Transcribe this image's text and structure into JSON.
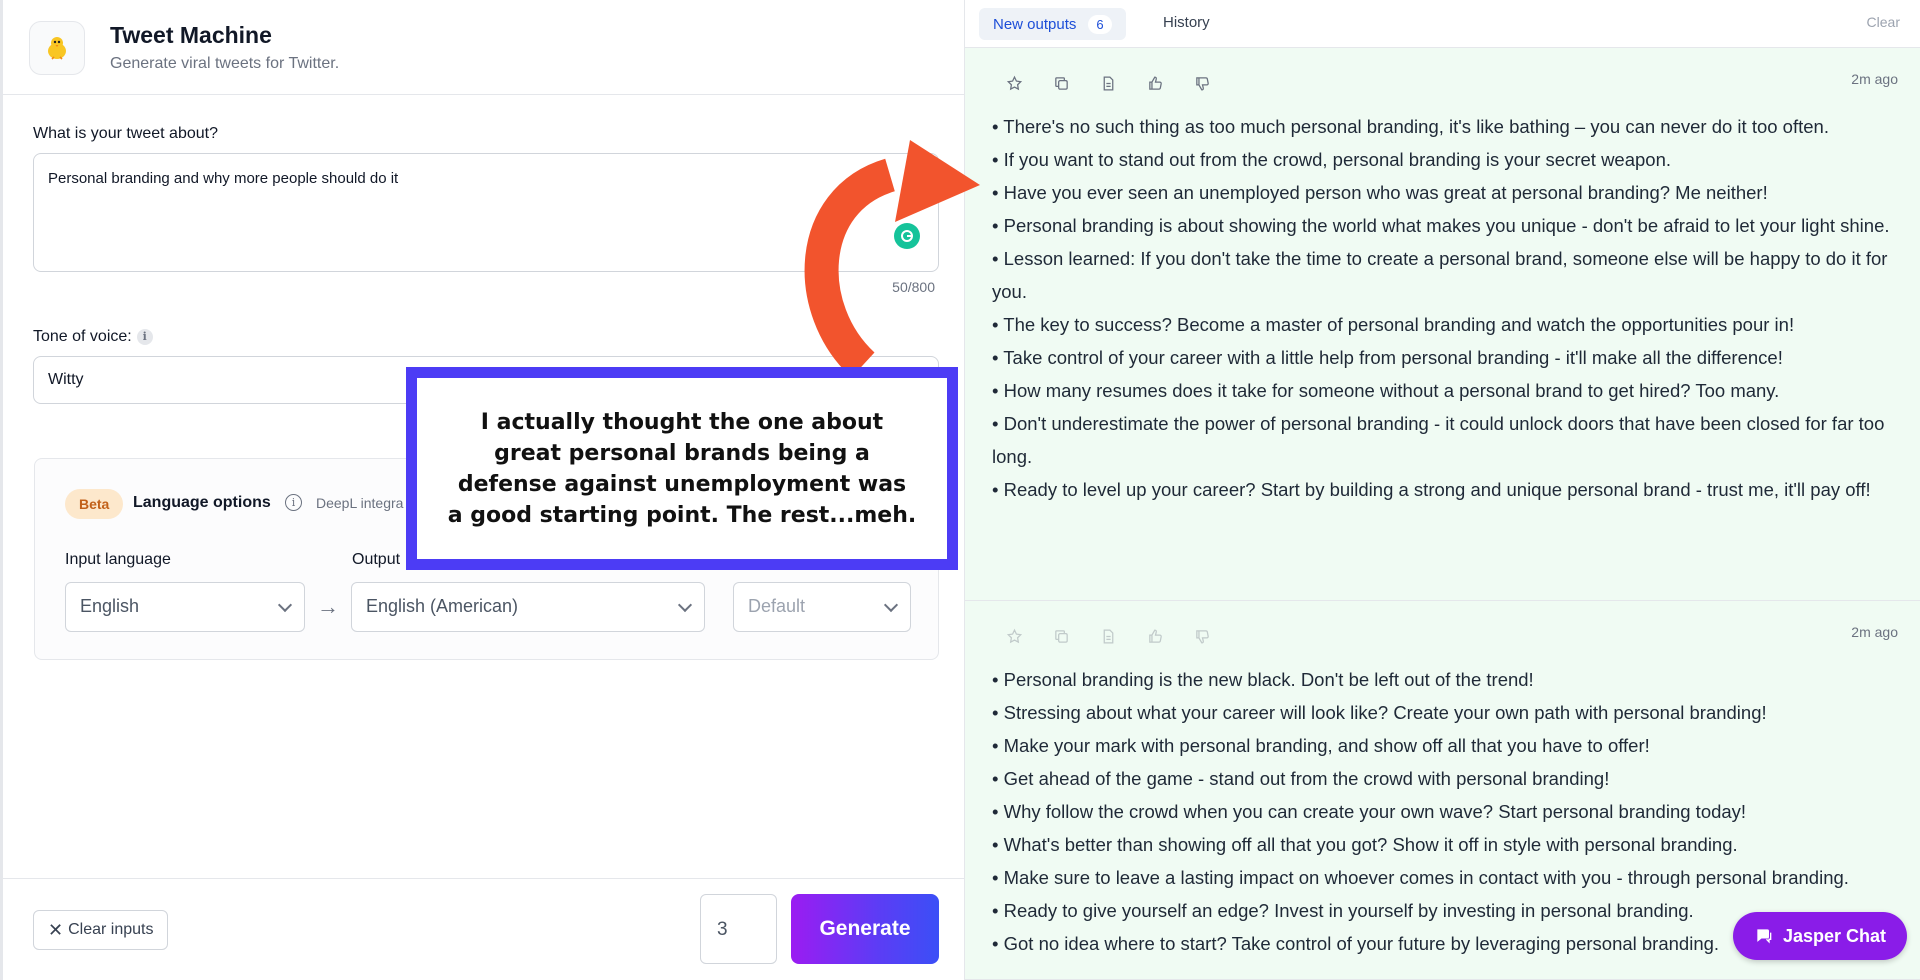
{
  "app": {
    "title": "Tweet Machine",
    "subtitle": "Generate viral tweets for Twitter."
  },
  "form": {
    "topic_label": "What is your tweet about?",
    "topic_value": "Personal branding and why more people should do it",
    "topic_counter": "50/800",
    "tone_label": "Tone of voice:",
    "tone_value": "Witty"
  },
  "language": {
    "beta_badge": "Beta",
    "title": "Language options",
    "deepl_text": "DeepL integra",
    "input_label": "Input language",
    "output_label": "Output",
    "input_value": "English",
    "output_value": "English (American)",
    "formality_value": "Default"
  },
  "footer": {
    "clear_label": "Clear inputs",
    "quantity": "3",
    "generate_label": "Generate"
  },
  "tabs": {
    "new_outputs": "New outputs",
    "new_count": "6",
    "history": "History",
    "clear": "Clear"
  },
  "outputs": [
    {
      "time": "2m ago",
      "lines": [
        "• There's no such thing as too much personal branding, it's like bathing – you can never do it too often.",
        "• If you want to stand out from the crowd, personal branding is your secret weapon.",
        "• Have you ever seen an unemployed person who was great at personal branding? Me neither!",
        "• Personal branding is about showing the world what makes you unique - don't be afraid to let your light shine.",
        "• Lesson learned: If you don't take the time to create a personal brand, someone else will be happy to do it for you.",
        "• The key to success? Become a master of personal branding and watch the opportunities pour in!",
        "• Take control of your career with a little help from personal branding - it'll make all the difference!",
        "• How many resumes does it take for someone without a personal brand to get hired? Too many.",
        "• Don't underestimate the power of personal branding - it could unlock doors that have been closed for far too long.",
        "• Ready to level up your career? Start by building a strong and unique personal brand - trust me, it'll pay off!"
      ]
    },
    {
      "time": "2m ago",
      "lines": [
        "• Personal branding is the new black. Don't be left out of the trend!",
        "• Stressing about what your career will look like? Create your own path with personal branding!",
        "• Make your mark with personal branding, and show off all that you have to offer!",
        "• Get ahead of the game - stand out from the crowd with personal branding!",
        "• Why follow the crowd when you can create your own wave? Start personal branding today!",
        "• What's better than showing off all that you got? Show it off in style with personal branding.",
        "• Make sure to leave a lasting impact on whoever comes in contact with you - through personal branding.",
        "• Ready to give yourself an edge? Invest in yourself by investing in personal branding.",
        "• Got no idea where to start? Take control of your future by leveraging personal branding."
      ]
    }
  ],
  "chat": {
    "label": "Jasper Chat"
  },
  "annotation": {
    "text": "I actually thought the one about great personal brands being a defense against unemployment was a good starting point. The rest...meh."
  },
  "colors": {
    "accent_purple": "#8a1ce8",
    "annotation_border": "#4c3cf5",
    "annotation_arrow": "#f2542d",
    "output_bg": "#f0fbf3"
  }
}
